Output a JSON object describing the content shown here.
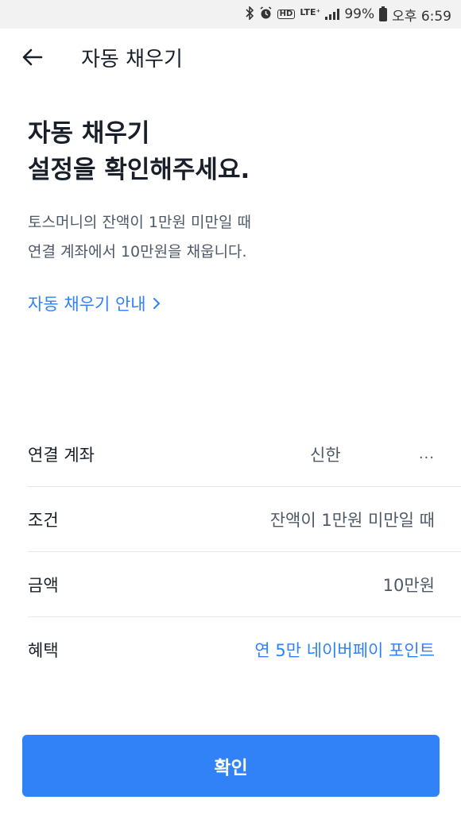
{
  "status_bar": {
    "icons": [
      "bluetooth-icon",
      "alarm-icon",
      "hd-icon",
      "lte-icon",
      "signal-icon"
    ],
    "lte_label": "LTE⁺",
    "hd_label": "HD",
    "battery": "99%",
    "time": "오후 6:59"
  },
  "appbar": {
    "title": "자동 채우기"
  },
  "headline": {
    "line1": "자동 채우기",
    "line2": "설정을 확인해주세요."
  },
  "description": {
    "line1": "토스머니의 잔액이 1만원 미만일 때",
    "line2": "연결 계좌에서 10만원을 채웁니다."
  },
  "guide_link": {
    "label": "자동 채우기 안내"
  },
  "details": [
    {
      "label": "연결 계좌",
      "value": "신한",
      "extra": "..."
    },
    {
      "label": "조건",
      "value": "잔액이 1만원 미만일 때"
    },
    {
      "label": "금액",
      "value": "10만원"
    },
    {
      "label": "혜택",
      "value": "연 5만 네이버페이 포인트"
    }
  ],
  "colors": {
    "accent": "#3182f6",
    "text_primary": "#191f28",
    "text_secondary": "#4e5968",
    "divider": "#e5e8eb"
  },
  "confirm_button": {
    "label": "확인"
  }
}
